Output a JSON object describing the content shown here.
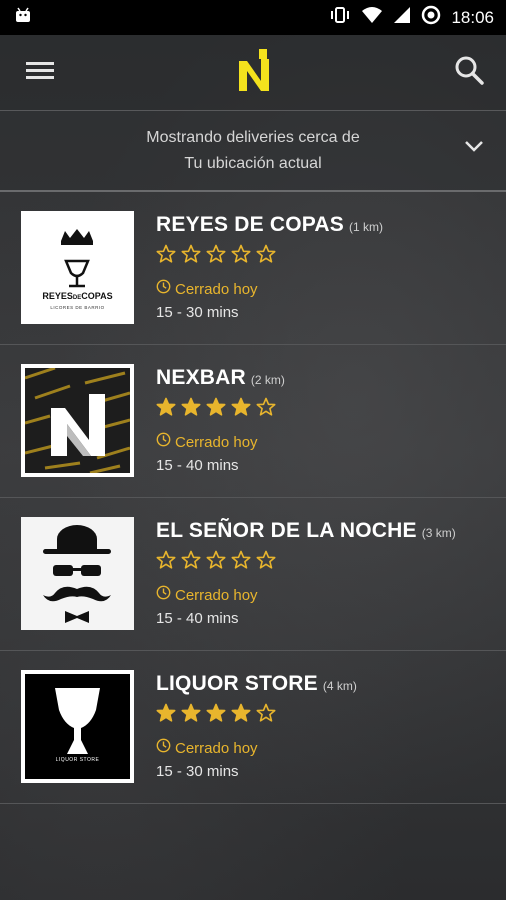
{
  "status_bar": {
    "time": "18:06",
    "icons": [
      "android-icon",
      "vibrate-icon",
      "wifi-icon",
      "signal-icon",
      "sync-icon"
    ]
  },
  "app_bar": {
    "menu_icon": "hamburger-menu-icon",
    "logo": "N",
    "search_icon": "search-icon"
  },
  "location": {
    "line1": "Mostrando deliveries cerca de",
    "line2": "Tu ubicación actual",
    "chevron": "chevron-down-icon"
  },
  "colors": {
    "accent": "#e8b52d",
    "logo_yellow": "#f4e21d",
    "star": "#e8b52d"
  },
  "stores": [
    {
      "name": "REYES DE COPAS",
      "distance": "(1 km)",
      "rating": 0,
      "status": "Cerrado hoy",
      "time": "15 - 30 mins"
    },
    {
      "name": "NEXBAR",
      "distance": "(2 km)",
      "rating": 4,
      "status": "Cerrado hoy",
      "time": "15 - 40 mins"
    },
    {
      "name": "EL SEÑOR DE LA NOCHE",
      "distance": "(3 km)",
      "rating": 0,
      "status": "Cerrado hoy",
      "time": "15 - 40 mins"
    },
    {
      "name": "LIQUOR STORE",
      "distance": "(4 km)",
      "rating": 4,
      "status": "Cerrado hoy",
      "time": "15 - 30 mins"
    }
  ],
  "logos": {
    "reyes_text": "REYES",
    "reyes_de": "DE",
    "reyes_copas": "COPAS",
    "reyes_sub": "LICORES DE BARRIO",
    "liquor_sub": "LIQUOR STORE"
  }
}
